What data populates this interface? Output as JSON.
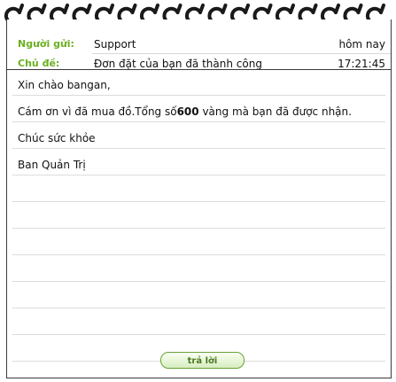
{
  "header": {
    "sender_label": "Người gửi:",
    "sender_value": "Support",
    "subject_label": "Chủ đề:",
    "subject_value": "Đơn đặt của bạn đã thành công",
    "date": "hôm nay",
    "time": "17:21:45"
  },
  "message": {
    "greeting": "Xin chào bangan,",
    "body_prefix": "Cám ơn vì đã mua đồ.Tổng số",
    "amount": "600",
    "body_suffix": " vàng mà bạn đã được nhận.",
    "wish": "Chúc sức khỏe",
    "signature": "Ban Quản Trị"
  },
  "actions": {
    "reply_label": "trả lời"
  },
  "colors": {
    "label_green": "#6bb021",
    "border": "#3a3a3a"
  },
  "icons": [
    "spiral-binding-icon"
  ]
}
